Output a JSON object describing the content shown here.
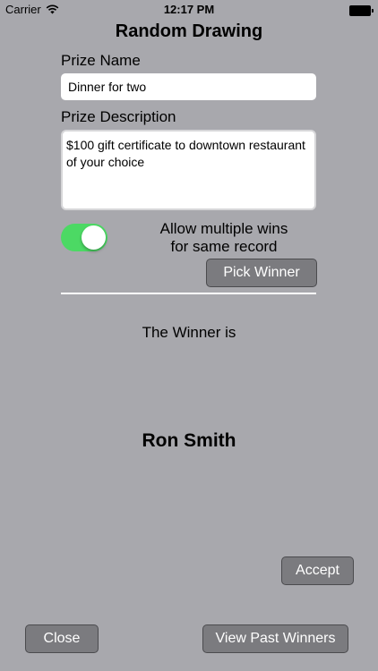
{
  "status_bar": {
    "carrier": "Carrier",
    "time": "12:17 PM",
    "wifi_icon": "wifi-icon",
    "battery_icon": "battery-icon"
  },
  "title": "Random Drawing",
  "prize_name": {
    "label": "Prize Name",
    "value": "Dinner for two"
  },
  "prize_description": {
    "label": "Prize Description",
    "value": "$100 gift certificate to downtown restaurant of your choice"
  },
  "allow_multiple": {
    "label_line1": "Allow multiple wins",
    "label_line2": "for same record",
    "enabled": true,
    "on_color": "#4cd964"
  },
  "buttons": {
    "pick_winner": "Pick Winner",
    "accept": "Accept",
    "close": "Close",
    "view_past_winners": "View Past Winners"
  },
  "winner": {
    "heading": "The Winner is",
    "name": "Ron Smith"
  },
  "colors": {
    "background": "#a8a8ad",
    "button": "#7b7b7f"
  }
}
